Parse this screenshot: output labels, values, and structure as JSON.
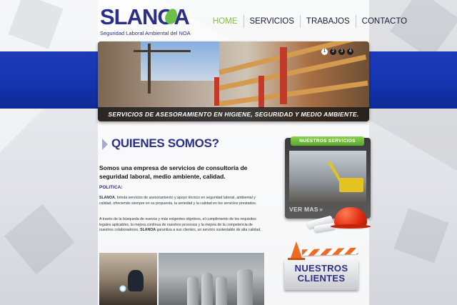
{
  "brand": {
    "name": "SLANOA",
    "tagline": "Seguridad Laboral Ambiental del NOA",
    "color": "#2c2f86",
    "accent": "#7cc340"
  },
  "nav": {
    "items": [
      {
        "label": "HOME",
        "active": true
      },
      {
        "label": "SERVICIOS",
        "active": false
      },
      {
        "label": "TRABAJOS",
        "active": false
      },
      {
        "label": "CONTACTO",
        "active": false
      }
    ]
  },
  "hero": {
    "caption": "SERVICIOS DE ASESORAMIENTO EN HIGIENE, SEGURIDAD Y MEDIO AMBIENTE.",
    "slides": [
      "1",
      "2",
      "3",
      "4"
    ],
    "active_slide": 1
  },
  "about": {
    "title": "QUIENES SOMOS?",
    "intro": "Somos una empresa de servicios de consultoría de seguridad laboral, medio ambiente, calidad.",
    "policy_label": "POLITICA:",
    "paragraph1_brand": "SLANOA",
    "paragraph1": ", brinda servicios de asesoramiento y apoyo técnico en seguridad laboral, ambiental y calidad, ofreciendo siempre en su propuesta, la seriedad y la calidad en los servicios prestados.",
    "paragraph2_a": "A través de la búsqueda de nuevos y más exigentes objetivos, el cumplimiento de los requisitos legales aplicables, la mejora continua de nuestros procesos y la mejora de la competencia de nuestros colaboradores, ",
    "paragraph2_brand": "SLANOA",
    "paragraph2_b": " garantiza a sus clientes, un servicio sustentable de alta calidad."
  },
  "sidebar": {
    "services_title": "NUESTROS SERVICIOS",
    "services_link": "VER MAS",
    "services_chevron": "»",
    "clients_line1": "NUESTROS",
    "clients_line2": "CLIENTES"
  },
  "icons": {
    "services_arrow": "chevron-double-right-icon",
    "title_arrow": "triangle-right-icon"
  }
}
